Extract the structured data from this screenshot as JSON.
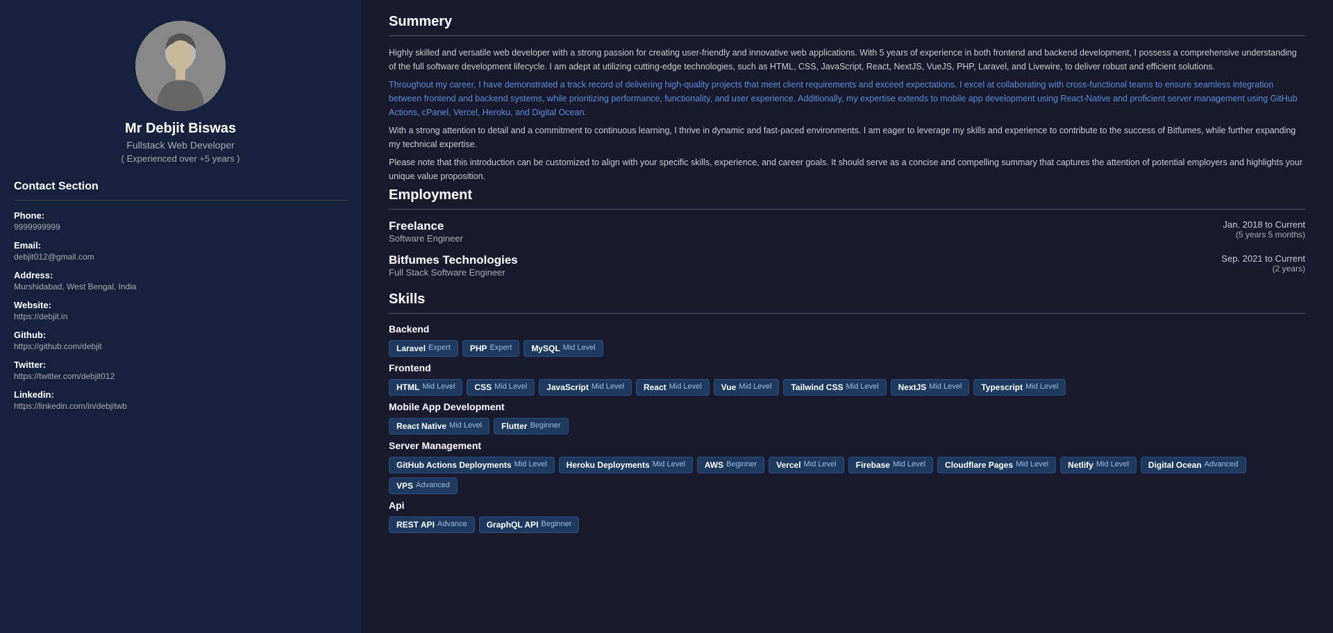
{
  "sidebar": {
    "name": "Mr Debjit Biswas",
    "title": "Fullstack Web Developer",
    "experience": "( Experienced over +5 years )",
    "contact_heading": "Contact Section",
    "contacts": [
      {
        "label": "Phone:",
        "value": "9999999999"
      },
      {
        "label": "Email:",
        "value": "debjit012@gmail.com"
      },
      {
        "label": "Address:",
        "value": "Murshidabad, West Bengal, India"
      },
      {
        "label": "Website:",
        "value": "https://debjit.in"
      },
      {
        "label": "Github:",
        "value": "https://github.com/debjit"
      },
      {
        "label": "Twitter:",
        "value": "https://twitter.com/debjit012"
      },
      {
        "label": "Linkedin:",
        "value": "https://linkedin.com/in/debjitwb"
      }
    ]
  },
  "main": {
    "summary": {
      "title": "Summery",
      "paragraphs": [
        {
          "text": "Highly skilled and versatile web developer with a strong passion for creating user-friendly and innovative web applications. With 5 years of experience in both frontend and backend development, I possess a comprehensive understanding of the full software development lifecycle. I am adept at utilizing cutting-edge technologies, such as HTML, CSS, JavaScript, React, NextJS, VueJS, PHP, Laravel, and Livewire, to deliver robust and efficient solutions.",
          "style": "normal"
        },
        {
          "text": "Throughout my career, I have demonstrated a track record of delivering high-quality projects that meet client requirements and exceed expectations. I excel at collaborating with cross-functional teams to ensure seamless integration between frontend and backend systems, while prioritizing performance, functionality, and user experience. Additionally, my expertise extends to mobile app development using React-Native and proficient server management using GitHub Actions, cPanel, Vercel, Heroku, and Digital Ocean.",
          "style": "highlight"
        },
        {
          "text": "With a strong attention to detail and a commitment to continuous learning, I thrive in dynamic and fast-paced environments. I am eager to leverage my skills and experience to contribute to the success of Bitfumes, while further expanding my technical expertise.",
          "style": "normal"
        },
        {
          "text": "Please note that this introduction can be customized to align with your specific skills, experience, and career goals. It should serve as a concise and compelling summary that captures the attention of potential employers and highlights your unique value proposition.",
          "style": "normal"
        }
      ]
    },
    "employment": {
      "title": "Employment",
      "jobs": [
        {
          "company": "Freelance",
          "role": "Software Engineer",
          "dates": "Jan. 2018 to Current",
          "duration": "(5 years 5 months)"
        },
        {
          "company": "Bitfumes Technologies",
          "role": "Full Stack Software Engineer",
          "dates": "Sep. 2021 to Current",
          "duration": "(2 years)"
        }
      ]
    },
    "skills": {
      "title": "Skills",
      "categories": [
        {
          "name": "Backend",
          "skills": [
            {
              "name": "Laravel",
              "level": "Expert"
            },
            {
              "name": "PHP",
              "level": "Expert"
            },
            {
              "name": "MySQL",
              "level": "Mid Level"
            }
          ]
        },
        {
          "name": "Frontend",
          "skills": [
            {
              "name": "HTML",
              "level": "Mid Level"
            },
            {
              "name": "CSS",
              "level": "Mid Level"
            },
            {
              "name": "JavaScript",
              "level": "Mid Level"
            },
            {
              "name": "React",
              "level": "Mid Level"
            },
            {
              "name": "Vue",
              "level": "Mid Level"
            },
            {
              "name": "Tailwind CSS",
              "level": "Mid Level"
            },
            {
              "name": "NextJS",
              "level": "Mid Level"
            },
            {
              "name": "Typescript",
              "level": "Mid Level"
            }
          ]
        },
        {
          "name": "Mobile App Development",
          "skills": [
            {
              "name": "React Native",
              "level": "Mid Level"
            },
            {
              "name": "Flutter",
              "level": "Beginner"
            }
          ]
        },
        {
          "name": "Server Management",
          "skills": [
            {
              "name": "GitHub Actions Deployments",
              "level": "Mid Level"
            },
            {
              "name": "Heroku Deployments",
              "level": "Mid Level"
            },
            {
              "name": "AWS",
              "level": "Beginner"
            },
            {
              "name": "Vercel",
              "level": "Mid Level"
            },
            {
              "name": "Firebase",
              "level": "Mid Level"
            },
            {
              "name": "Cloudflare Pages",
              "level": "Mid Level"
            },
            {
              "name": "Netlify",
              "level": "Mid Level"
            },
            {
              "name": "Digital Ocean",
              "level": "Advanced"
            },
            {
              "name": "VPS",
              "level": "Advanced"
            }
          ]
        },
        {
          "name": "Api",
          "skills": [
            {
              "name": "REST API",
              "level": "Advance"
            },
            {
              "name": "GraphQL API",
              "level": "Beginner"
            }
          ]
        }
      ]
    }
  }
}
